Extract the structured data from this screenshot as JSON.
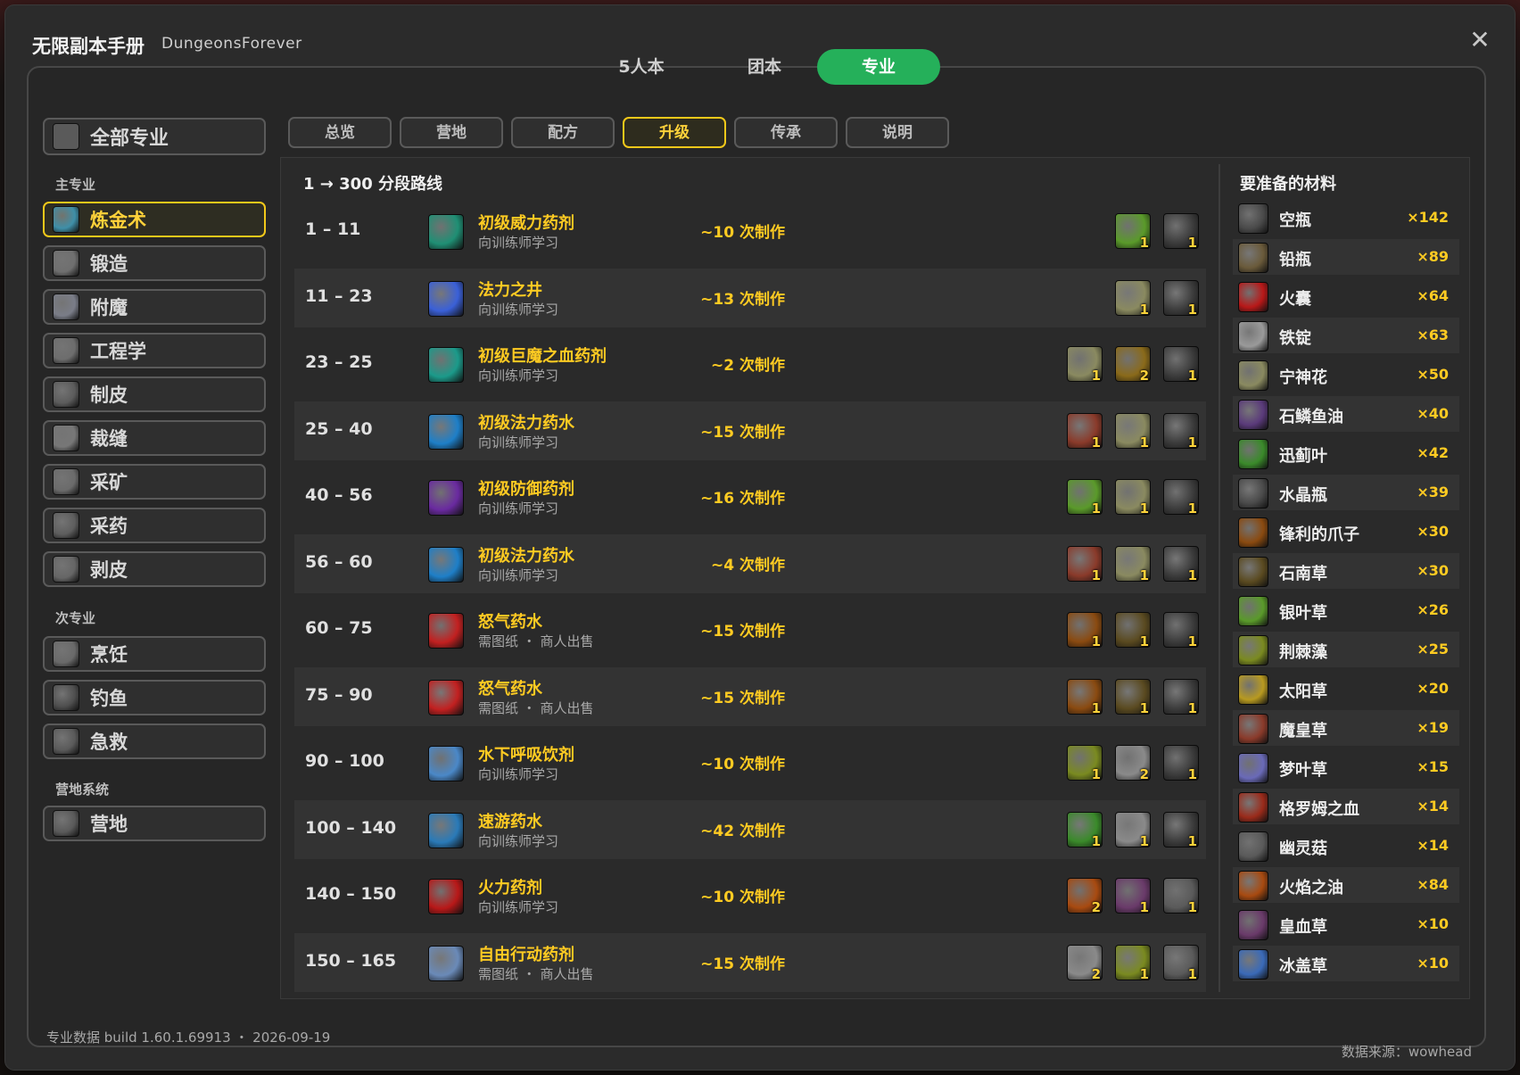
{
  "window": {
    "title": "无限副本手册",
    "subtitle": "DungeonsForever"
  },
  "top_tabs": [
    {
      "label": "5人本",
      "active": false
    },
    {
      "label": "团本",
      "active": false
    },
    {
      "label": "专业",
      "active": true
    }
  ],
  "sidebar": {
    "all_label": "全部专业",
    "all_icon": "book-icon",
    "primary_header": "主专业",
    "primary": [
      {
        "label": "炼金术",
        "icon": "potion-icon",
        "color": "#3f8fa8",
        "active": true
      },
      {
        "label": "锻造",
        "icon": "anvil-icon",
        "color": "#6f6f6f",
        "active": false
      },
      {
        "label": "附魔",
        "icon": "scroll-icon",
        "color": "#7a7d88",
        "active": false
      },
      {
        "label": "工程学",
        "icon": "gear-icon",
        "color": "#6d6d6d",
        "active": false
      },
      {
        "label": "制皮",
        "icon": "leather-icon",
        "color": "#5c5c5c",
        "active": false
      },
      {
        "label": "裁缝",
        "icon": "spool-icon",
        "color": "#777777",
        "active": false
      },
      {
        "label": "采矿",
        "icon": "pickaxe-icon",
        "color": "#6b6b6b",
        "active": false
      },
      {
        "label": "采药",
        "icon": "herb-icon",
        "color": "#5e5e5e",
        "active": false
      },
      {
        "label": "剥皮",
        "icon": "skinning-icon",
        "color": "#666666",
        "active": false
      }
    ],
    "secondary_header": "次专业",
    "secondary": [
      {
        "label": "烹饪",
        "icon": "cooking-icon",
        "color": "#6a6a6a",
        "active": false
      },
      {
        "label": "钓鱼",
        "icon": "fishing-icon",
        "color": "#4f4f4f",
        "active": false
      },
      {
        "label": "急救",
        "icon": "first-aid-icon",
        "color": "#5a5a5a",
        "active": false
      }
    ],
    "camp_header": "营地系统",
    "camp": [
      {
        "label": "营地",
        "icon": "campfire-icon",
        "color": "#5a5a5a",
        "active": false
      }
    ]
  },
  "sub_tabs": [
    {
      "label": "总览",
      "active": false
    },
    {
      "label": "营地",
      "active": false
    },
    {
      "label": "配方",
      "active": false
    },
    {
      "label": "升级",
      "active": true
    },
    {
      "label": "传承",
      "active": false
    },
    {
      "label": "说明",
      "active": false
    }
  ],
  "route": {
    "title": "1 → 300 分段路线",
    "rows": [
      {
        "range": "1 – 11",
        "name": "初级威力药剂",
        "source": "向训练师学习",
        "crafts": "~10 次制作",
        "icon": "green-potion-icon",
        "icon_color": "#1f8f74",
        "mats": [
          {
            "icon": "peacebloom-leaf-icon",
            "color": "#5a9a2a",
            "n": "1"
          },
          {
            "icon": "empty-vial-icon",
            "color": "#3c3c3c",
            "n": "1"
          }
        ]
      },
      {
        "range": "11 – 23",
        "name": "法力之井",
        "source": "向训练师学习",
        "crafts": "~13 次制作",
        "icon": "arcane-icon",
        "icon_color": "#3a60d8",
        "mats": [
          {
            "icon": "daisy-icon",
            "color": "#8a8a60",
            "n": "1"
          },
          {
            "icon": "empty-vial-icon",
            "color": "#3c3c3c",
            "n": "1"
          }
        ]
      },
      {
        "range": "23 – 25",
        "name": "初级巨魔之血药剂",
        "source": "向训练师学习",
        "crafts": "~2 次制作",
        "icon": "teal-potion-icon",
        "icon_color": "#1b9a8a",
        "mats": [
          {
            "icon": "daisy-icon",
            "color": "#8a8a60",
            "n": "1"
          },
          {
            "icon": "root-icon",
            "color": "#8a6a1a",
            "n": "2"
          },
          {
            "icon": "empty-vial-icon",
            "color": "#3c3c3c",
            "n": "1"
          }
        ]
      },
      {
        "range": "25 – 40",
        "name": "初级法力药水",
        "source": "向训练师学习",
        "crafts": "~15 次制作",
        "icon": "blue-potion-icon",
        "icon_color": "#1e7fc8",
        "mats": [
          {
            "icon": "rose-icon",
            "color": "#8a3a2a",
            "n": "1"
          },
          {
            "icon": "daisy-icon",
            "color": "#8a8a60",
            "n": "1"
          },
          {
            "icon": "empty-vial-icon",
            "color": "#3c3c3c",
            "n": "1"
          }
        ]
      },
      {
        "range": "40 – 56",
        "name": "初级防御药剂",
        "source": "向训练师学习",
        "crafts": "~16 次制作",
        "icon": "purple-potion-icon",
        "icon_color": "#6a2aa0",
        "mats": [
          {
            "icon": "peacebloom-leaf-icon",
            "color": "#5a9a2a",
            "n": "1"
          },
          {
            "icon": "daisy-icon",
            "color": "#8a8a60",
            "n": "1"
          },
          {
            "icon": "empty-vial-icon",
            "color": "#3c3c3c",
            "n": "1"
          }
        ]
      },
      {
        "range": "56 – 60",
        "name": "初级法力药水",
        "source": "向训练师学习",
        "crafts": "~4 次制作",
        "icon": "blue-potion-icon",
        "icon_color": "#1e7fc8",
        "mats": [
          {
            "icon": "rose-icon",
            "color": "#8a3a2a",
            "n": "1"
          },
          {
            "icon": "daisy-icon",
            "color": "#8a8a60",
            "n": "1"
          },
          {
            "icon": "empty-vial-icon",
            "color": "#3c3c3c",
            "n": "1"
          }
        ]
      },
      {
        "range": "60 – 75",
        "name": "怒气药水",
        "source": "需图纸 ・ 商人出售",
        "crafts": "~15 次制作",
        "icon": "red-potion-icon",
        "icon_color": "#c22020",
        "mats": [
          {
            "icon": "claw-icon",
            "color": "#8a4a10",
            "n": "1"
          },
          {
            "icon": "briarthorn-icon",
            "color": "#5a4a20",
            "n": "1"
          },
          {
            "icon": "empty-vial-icon",
            "color": "#3c3c3c",
            "n": "1"
          }
        ]
      },
      {
        "range": "75 – 90",
        "name": "怒气药水",
        "source": "需图纸 ・ 商人出售",
        "crafts": "~15 次制作",
        "icon": "red-potion-icon",
        "icon_color": "#c22020",
        "mats": [
          {
            "icon": "claw-icon",
            "color": "#8a4a10",
            "n": "1"
          },
          {
            "icon": "briarthorn-icon",
            "color": "#5a4a20",
            "n": "1"
          },
          {
            "icon": "empty-vial-icon",
            "color": "#3c3c3c",
            "n": "1"
          }
        ]
      },
      {
        "range": "90 – 100",
        "name": "水下呼吸饮剂",
        "source": "向训练师学习",
        "crafts": "~10 次制作",
        "icon": "water-breathing-icon",
        "icon_color": "#4a88c8",
        "mats": [
          {
            "icon": "kingsblood-leaf-icon",
            "color": "#7a8a20",
            "n": "1"
          },
          {
            "icon": "fire-oil-icon",
            "color": "#8a8a8a",
            "n": "2"
          },
          {
            "icon": "empty-vial-icon",
            "color": "#3c3c3c",
            "n": "1"
          }
        ]
      },
      {
        "range": "100 – 140",
        "name": "速游药水",
        "source": "向训练师学习",
        "crafts": "~42 次制作",
        "icon": "swim-potion-icon",
        "icon_color": "#2a7ab8",
        "mats": [
          {
            "icon": "swiftthistle-icon",
            "color": "#3a8a2a",
            "n": "1"
          },
          {
            "icon": "leaded-vial-icon",
            "color": "#8a8a8a",
            "n": "1"
          },
          {
            "icon": "empty-vial-icon",
            "color": "#3c3c3c",
            "n": "1"
          }
        ]
      },
      {
        "range": "140 – 150",
        "name": "火力药剂",
        "source": "向训练师学习",
        "crafts": "~10 次制作",
        "icon": "fire-potion-icon",
        "icon_color": "#b81818",
        "mats": [
          {
            "icon": "fire-oil-icon",
            "color": "#a84a10",
            "n": "2"
          },
          {
            "icon": "kingsblood-icon",
            "color": "#6a3a6a",
            "n": "1"
          },
          {
            "icon": "leaded-vial-icon",
            "color": "#5a5a5a",
            "n": "1"
          }
        ]
      },
      {
        "range": "150 – 165",
        "name": "自由行动药剂",
        "source": "需图纸 ・ 商人出售",
        "crafts": "~15 次制作",
        "icon": "free-action-icon",
        "icon_color": "#6a8ab8",
        "mats": [
          {
            "icon": "blackmouth-oil-icon",
            "color": "#8a8a8a",
            "n": "2"
          },
          {
            "icon": "stranglekelp-icon",
            "color": "#7a8a20",
            "n": "1"
          },
          {
            "icon": "leaded-vial-icon",
            "color": "#5a5a5a",
            "n": "1"
          }
        ]
      }
    ]
  },
  "materials": {
    "title": "要准备的材料",
    "items": [
      {
        "name": "空瓶",
        "count": "×142",
        "icon": "empty-vial-icon",
        "color": "#4a4a4a"
      },
      {
        "name": "铅瓶",
        "count": "×89",
        "icon": "leaded-vial-icon",
        "color": "#6a5a3a"
      },
      {
        "name": "火囊",
        "count": "×64",
        "icon": "fire-gland-icon",
        "color": "#b81818"
      },
      {
        "name": "铁锭",
        "count": "×63",
        "icon": "iron-bar-icon",
        "color": "#9a9a9a"
      },
      {
        "name": "宁神花",
        "count": "×50",
        "icon": "daisy-icon",
        "color": "#8a8a60"
      },
      {
        "name": "石鳞鱼油",
        "count": "×40",
        "icon": "fish-oil-icon",
        "color": "#5a3a7a"
      },
      {
        "name": "迅蓟叶",
        "count": "×42",
        "icon": "swiftthistle-icon",
        "color": "#3a8a2a"
      },
      {
        "name": "水晶瓶",
        "count": "×39",
        "icon": "crystal-vial-icon",
        "color": "#4a4a4a"
      },
      {
        "name": "锋利的爪子",
        "count": "×30",
        "icon": "claw-icon",
        "color": "#8a4a10"
      },
      {
        "name": "石南草",
        "count": "×30",
        "icon": "briarthorn-icon",
        "color": "#5a4a20"
      },
      {
        "name": "银叶草",
        "count": "×26",
        "icon": "silverleaf-icon",
        "color": "#5a9a2a"
      },
      {
        "name": "荆棘藻",
        "count": "×25",
        "icon": "stranglekelp-icon",
        "color": "#7a8a20"
      },
      {
        "name": "太阳草",
        "count": "×20",
        "icon": "sungrass-icon",
        "color": "#b89a20"
      },
      {
        "name": "魔皇草",
        "count": "×19",
        "icon": "rose-icon",
        "color": "#8a3a2a"
      },
      {
        "name": "梦叶草",
        "count": "×15",
        "icon": "dreamfoil-icon",
        "color": "#6a6ab8"
      },
      {
        "name": "格罗姆之血",
        "count": "×14",
        "icon": "gromsblood-icon",
        "color": "#9a2a1a"
      },
      {
        "name": "幽灵菇",
        "count": "×14",
        "icon": "ghost-mushroom-icon",
        "color": "#5a5a5a"
      },
      {
        "name": "火焰之油",
        "count": "×84",
        "icon": "fire-oil-icon",
        "color": "#a84a10"
      },
      {
        "name": "皇血草",
        "count": "×10",
        "icon": "kingsblood-icon",
        "color": "#6a3a6a"
      },
      {
        "name": "冰盖草",
        "count": "×10",
        "icon": "icecap-icon",
        "color": "#3a6ab8"
      }
    ]
  },
  "footer": {
    "build": "专业数据 build 1.60.1.69913 ・ 2026-09-19",
    "source": "数据来源：wowhead"
  },
  "colors": {
    "accent_green": "#25b05a",
    "accent_yellow": "#ffcb22",
    "active_border": "#f2c81a"
  }
}
